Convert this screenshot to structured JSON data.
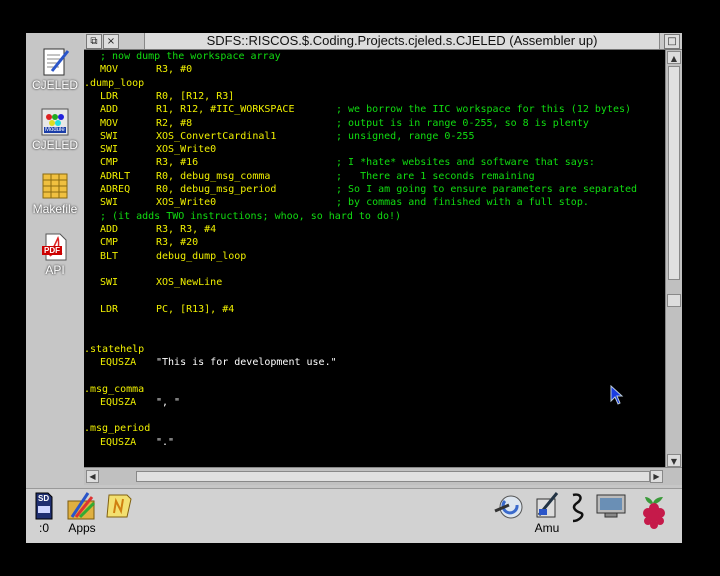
{
  "window": {
    "title": "SDFS::RISCOS.$.Coding.Projects.cjeled.s.CJELED (Assembler up)",
    "back_glyph": "⧉",
    "close_glyph": "×",
    "toggle_glyph": "□"
  },
  "desktop_icons": [
    {
      "label": "CJELED",
      "icon": "edit-document-icon"
    },
    {
      "label": "CJELED",
      "icon": "module-icon"
    },
    {
      "label": "Makefile",
      "icon": "makefile-icon"
    },
    {
      "label": "API",
      "icon": "pdf-icon"
    }
  ],
  "pdf_badge": "PDF",
  "module_badge": "Module",
  "colors": {
    "comment": "#11dd11",
    "label": "#f0f000",
    "mnemonic": "#f0f000",
    "operand": "#f0f000",
    "string": "#ffffff",
    "desktop": "#c6c6c6",
    "editor_bg": "#000000"
  },
  "code_lines": [
    {
      "indent": "    ",
      "label": "",
      "op": "",
      "args": "",
      "comment": "; now dump the workspace array"
    },
    {
      "indent": "    ",
      "label": "",
      "op": "MOV",
      "args": "R3, #0",
      "comment": ""
    },
    {
      "indent": "",
      "label": ".dump_loop",
      "op": "",
      "args": "",
      "comment": ""
    },
    {
      "indent": "    ",
      "label": "",
      "op": "LDR",
      "args": "R0, [R12, R3]",
      "comment": ""
    },
    {
      "indent": "    ",
      "label": "",
      "op": "ADD",
      "args": "R1, R12, #IIC_WORKSPACE",
      "comment": "; we borrow the IIC workspace for this (12 bytes)"
    },
    {
      "indent": "    ",
      "label": "",
      "op": "MOV",
      "args": "R2, #8",
      "comment": "; output is in range 0-255, so 8 is plenty"
    },
    {
      "indent": "    ",
      "label": "",
      "op": "SWI",
      "args": "XOS_ConvertCardinal1",
      "comment": "; unsigned, range 0-255"
    },
    {
      "indent": "    ",
      "label": "",
      "op": "SWI",
      "args": "XOS_Write0",
      "comment": ""
    },
    {
      "indent": "    ",
      "label": "",
      "op": "CMP",
      "args": "R3, #16",
      "comment": "; I *hate* websites and software that says:"
    },
    {
      "indent": "    ",
      "label": "",
      "op": "ADRLT",
      "args": "R0, debug_msg_comma",
      "comment": ";   There are 1 seconds remaining"
    },
    {
      "indent": "    ",
      "label": "",
      "op": "ADREQ",
      "args": "R0, debug_msg_period",
      "comment": "; So I am going to ensure parameters are separated"
    },
    {
      "indent": "    ",
      "label": "",
      "op": "SWI",
      "args": "XOS_Write0",
      "comment": "; by commas and finished with a full stop."
    },
    {
      "indent": "    ",
      "label": "",
      "op": "",
      "args": "",
      "comment": "; (it adds TWO instructions; whoo, so hard to do!)"
    },
    {
      "indent": "    ",
      "label": "",
      "op": "ADD",
      "args": "R3, R3, #4",
      "comment": ""
    },
    {
      "indent": "    ",
      "label": "",
      "op": "CMP",
      "args": "R3, #20",
      "comment": ""
    },
    {
      "indent": "    ",
      "label": "",
      "op": "BLT",
      "args": "debug_dump_loop",
      "comment": ""
    },
    {
      "indent": "",
      "label": "",
      "op": "",
      "args": "",
      "comment": ""
    },
    {
      "indent": "    ",
      "label": "",
      "op": "SWI",
      "args": "XOS_NewLine",
      "comment": ""
    },
    {
      "indent": "",
      "label": "",
      "op": "",
      "args": "",
      "comment": ""
    },
    {
      "indent": "    ",
      "label": "",
      "op": "LDR",
      "args": "PC, [R13], #4",
      "comment": ""
    },
    {
      "indent": "",
      "label": "",
      "op": "",
      "args": "",
      "comment": ""
    },
    {
      "indent": "",
      "label": "",
      "op": "",
      "args": "",
      "comment": ""
    },
    {
      "indent": "",
      "label": ".statehelp",
      "op": "",
      "args": "",
      "comment": ""
    },
    {
      "indent": "    ",
      "label": "",
      "op": "EQUSZA",
      "args": "\"This is for development use.\"",
      "comment": ""
    },
    {
      "indent": "",
      "label": "",
      "op": "",
      "args": "",
      "comment": ""
    },
    {
      "indent": "",
      "label": ".msg_comma",
      "op": "",
      "args": "",
      "comment": ""
    },
    {
      "indent": "    ",
      "label": "",
      "op": "EQUSZA",
      "args": "\", \"",
      "comment": ""
    },
    {
      "indent": "",
      "label": "",
      "op": "",
      "args": "",
      "comment": ""
    },
    {
      "indent": "",
      "label": ".msg_period",
      "op": "",
      "args": "",
      "comment": ""
    },
    {
      "indent": "    ",
      "label": "",
      "op": "EQUSZA",
      "args": "\".\"",
      "comment": ""
    }
  ],
  "iconbar": {
    "left": [
      {
        "label": ":0",
        "icon": "sd-card-icon"
      },
      {
        "label": "Apps",
        "icon": "apps-icon"
      },
      {
        "label": "",
        "icon": "notepad-icon"
      }
    ],
    "right": [
      {
        "label": "",
        "icon": "configure-icon"
      },
      {
        "label": "Amu",
        "icon": "amu-icon"
      },
      {
        "label": "",
        "icon": "zap-icon"
      },
      {
        "label": "",
        "icon": "display-icon"
      },
      {
        "label": "",
        "icon": "raspberry-pi-icon"
      }
    ],
    "sd_badge": "SD"
  }
}
